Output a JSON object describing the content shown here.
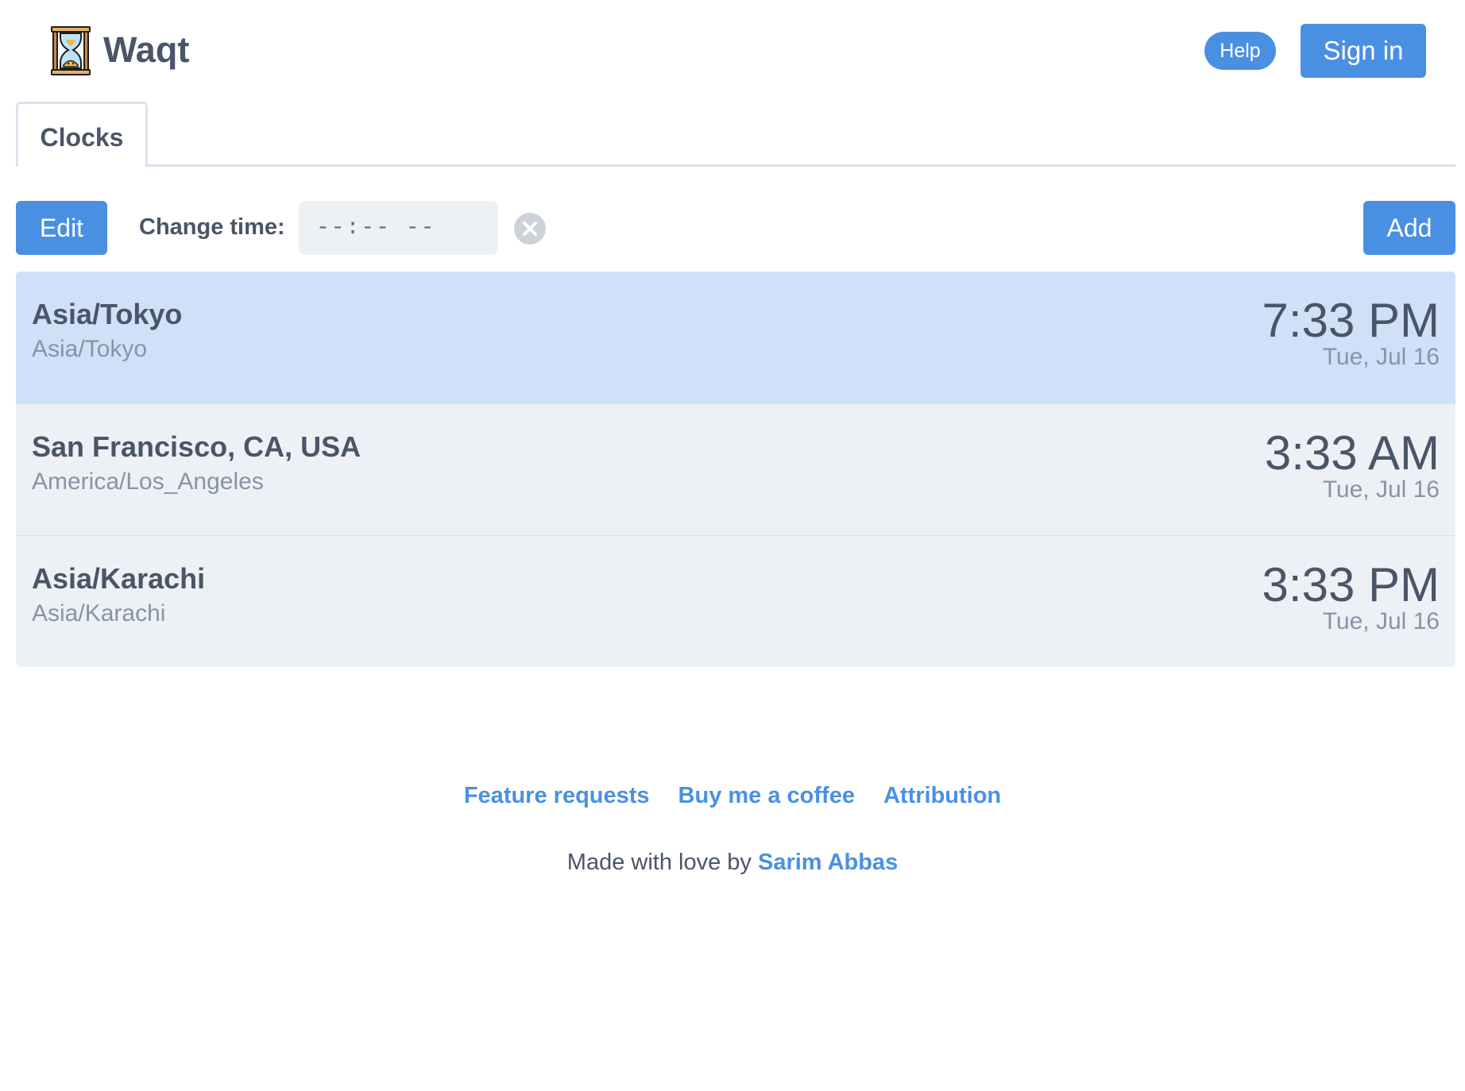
{
  "app": {
    "title": "Waqt"
  },
  "header": {
    "help_label": "Help",
    "signin_label": "Sign in"
  },
  "tabs": [
    {
      "label": "Clocks",
      "active": true
    }
  ],
  "toolbar": {
    "edit_label": "Edit",
    "change_time_label": "Change time:",
    "time_input_value": "",
    "time_input_placeholder": "--:-- --",
    "add_label": "Add"
  },
  "clocks": [
    {
      "name": "Asia/Tokyo",
      "zone": "Asia/Tokyo",
      "time": "7:33 PM",
      "date": "Tue, Jul 16",
      "selected": true
    },
    {
      "name": "San Francisco, CA, USA",
      "zone": "America/Los_Angeles",
      "time": "3:33 AM",
      "date": "Tue, Jul 16",
      "selected": false
    },
    {
      "name": "Asia/Karachi",
      "zone": "Asia/Karachi",
      "time": "3:33 PM",
      "date": "Tue, Jul 16",
      "selected": false
    }
  ],
  "footer": {
    "links": [
      "Feature requests",
      "Buy me a coffee",
      "Attribution"
    ],
    "made_with_text": "Made with love by",
    "author": "Sarim Abbas"
  },
  "icons": {
    "logo": "hourglass-icon",
    "clear": "clear-circle-icon"
  },
  "colors": {
    "accent": "#4a90e2",
    "selected_row": "#cfe0f8",
    "row_bg": "#edf1f5",
    "text": "#4a5568",
    "muted_text": "#8694a6"
  }
}
